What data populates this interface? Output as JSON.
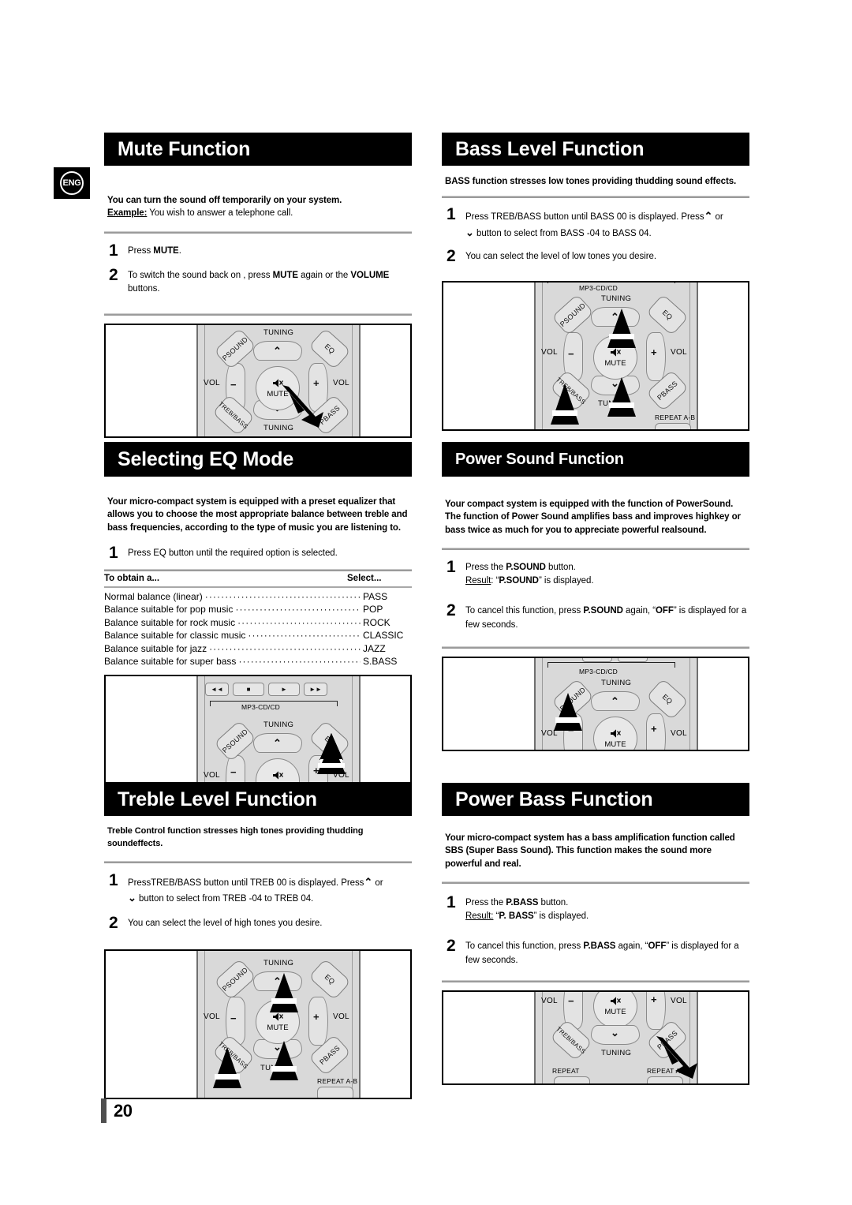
{
  "page": {
    "language_badge": "ENG",
    "number": "20"
  },
  "sections": {
    "mute": {
      "title": "Mute Function",
      "intro_bold": "You can turn the sound off temporarily on your system.",
      "example_label": "Example:",
      "example_text": " You wish to answer a telephone call.",
      "steps": [
        {
          "num": "1",
          "text_pre": "Press ",
          "bold1": "MUTE",
          "text_post": "."
        },
        {
          "num": "2",
          "text_pre": "To switch the sound back on , press ",
          "bold1": "MUTE",
          "text_mid": " again or the ",
          "bold2": "VOLUME",
          "text_post": " buttons."
        }
      ]
    },
    "eq": {
      "title": "Selecting  EQ Mode",
      "intro": "Your micro-compact system is equipped with a preset equalizer that allows you to choose the most appropriate balance between treble and bass frequencies, according to the type of music you are listening to.",
      "steps": [
        {
          "num": "1",
          "text": "Press EQ button until the required option is selected."
        }
      ],
      "table": {
        "headers": [
          "To obtain a...",
          "Select..."
        ],
        "rows": [
          {
            "label": "Normal balance (linear)",
            "value": "PASS"
          },
          {
            "label": "Balance suitable for pop music",
            "value": "POP"
          },
          {
            "label": "Balance suitable for rock music",
            "value": "ROCK"
          },
          {
            "label": "Balance suitable for classic music",
            "value": "CLASSIC"
          },
          {
            "label": "Balance suitable for jazz",
            "value": "JAZZ"
          },
          {
            "label": "Balance suitable for super bass",
            "value": "S.BASS"
          }
        ]
      }
    },
    "treble": {
      "title": "Treble Level Function",
      "intro": "Treble Control function stresses high tones providing thudding soundeffects.",
      "steps": [
        {
          "num": "1",
          "text_a": "PressTREB/BASS  button until TREB 00 is displayed. Press",
          "chev_up": "⌃",
          "text_b": " or",
          "text_c": " button to select from TREB -04 to TREB 04.",
          "chev_down": "⌄"
        },
        {
          "num": "2",
          "text": "You can select the level of high tones you desire."
        }
      ]
    },
    "bass_level": {
      "title": "Bass Level Function",
      "intro": "BASS function stresses low tones providing thudding sound effects.",
      "steps": [
        {
          "num": "1",
          "text_a": "Press TREB/BASS  button until  BASS 00 is displayed.  Press",
          "chev_up": "⌃",
          "text_b": " or",
          "text_c": " button to select from BASS -04 to BASS  04.",
          "chev_down": "⌄"
        },
        {
          "num": "2",
          "text": "You can select the level of low tones you desire."
        }
      ]
    },
    "power_sound": {
      "title": "Power Sound Function",
      "intro": "Your compact system is equipped with the function of PowerSound.\nThe function of Power Sound amplifies bass and improves highkey or bass twice as much for you to appreciate powerful realsound.",
      "steps": [
        {
          "num": "1",
          "text_pre": "Press the ",
          "bold1": "P.SOUND",
          "text_post": " button.",
          "result_label": "Result",
          "result_sep": ": ",
          "result_quote_open": "“",
          "result_bold": "P.SOUND",
          "result_quote_close": "”",
          "result_tail": " is displayed."
        },
        {
          "num": "2",
          "text_pre": "To cancel this function, press ",
          "bold1": "P.SOUND",
          "text_mid": " again, “",
          "bold2": "OFF",
          "text_post": "” is displayed for a few seconds."
        }
      ]
    },
    "power_bass": {
      "title": "Power Bass Function",
      "intro": "Your micro-compact system has a bass amplification function called SBS (Super Bass Sound). This function makes the sound more powerful and real.",
      "steps": [
        {
          "num": "1",
          "text_pre": "Press the ",
          "bold1": "P.BASS",
          "text_post": " button.",
          "result_label": "Result:",
          "result_sep": " ",
          "result_quote_open": "“",
          "result_bold": "P. BASS",
          "result_quote_close": "”",
          "result_tail": " is displayed."
        },
        {
          "num": "2",
          "text_pre": "To cancel this function, press ",
          "bold1": "P.BASS",
          "text_mid": " again, “",
          "bold2": "OFF",
          "text_post": "” is displayed  for a few seconds."
        }
      ]
    }
  },
  "remote": {
    "labels": {
      "mp3_cd": "MP3-CD/CD",
      "psound": "PSOUND",
      "eq": "EQ",
      "treb_bass": "TREB/BASS",
      "pbass": "PBASS",
      "tuning": "TUNING",
      "vol": "VOL",
      "mute": "MUTE",
      "minus": "−",
      "plus": "+",
      "chev_up": "⌃",
      "chev_down": "⌄",
      "repeat": "REPEAT",
      "repeat_ab": "REPEAT A-B",
      "repeat_trunc": "EAT",
      "repeat_ab_trunc": "REPEAT A-",
      "tuning_trunc": "TUNIN",
      "rew": "◄◄",
      "stop": "■",
      "play": "►",
      "ffwd": "►►",
      "mute_icon": "🔇"
    }
  },
  "colors": {
    "banner_bg": "#000000",
    "banner_text": "#ffffff",
    "rule": "#9b9b9b",
    "remote_body": "#d9d9d9",
    "button_face": "#e3e3e3",
    "page_bar": "#4f4f4f"
  }
}
